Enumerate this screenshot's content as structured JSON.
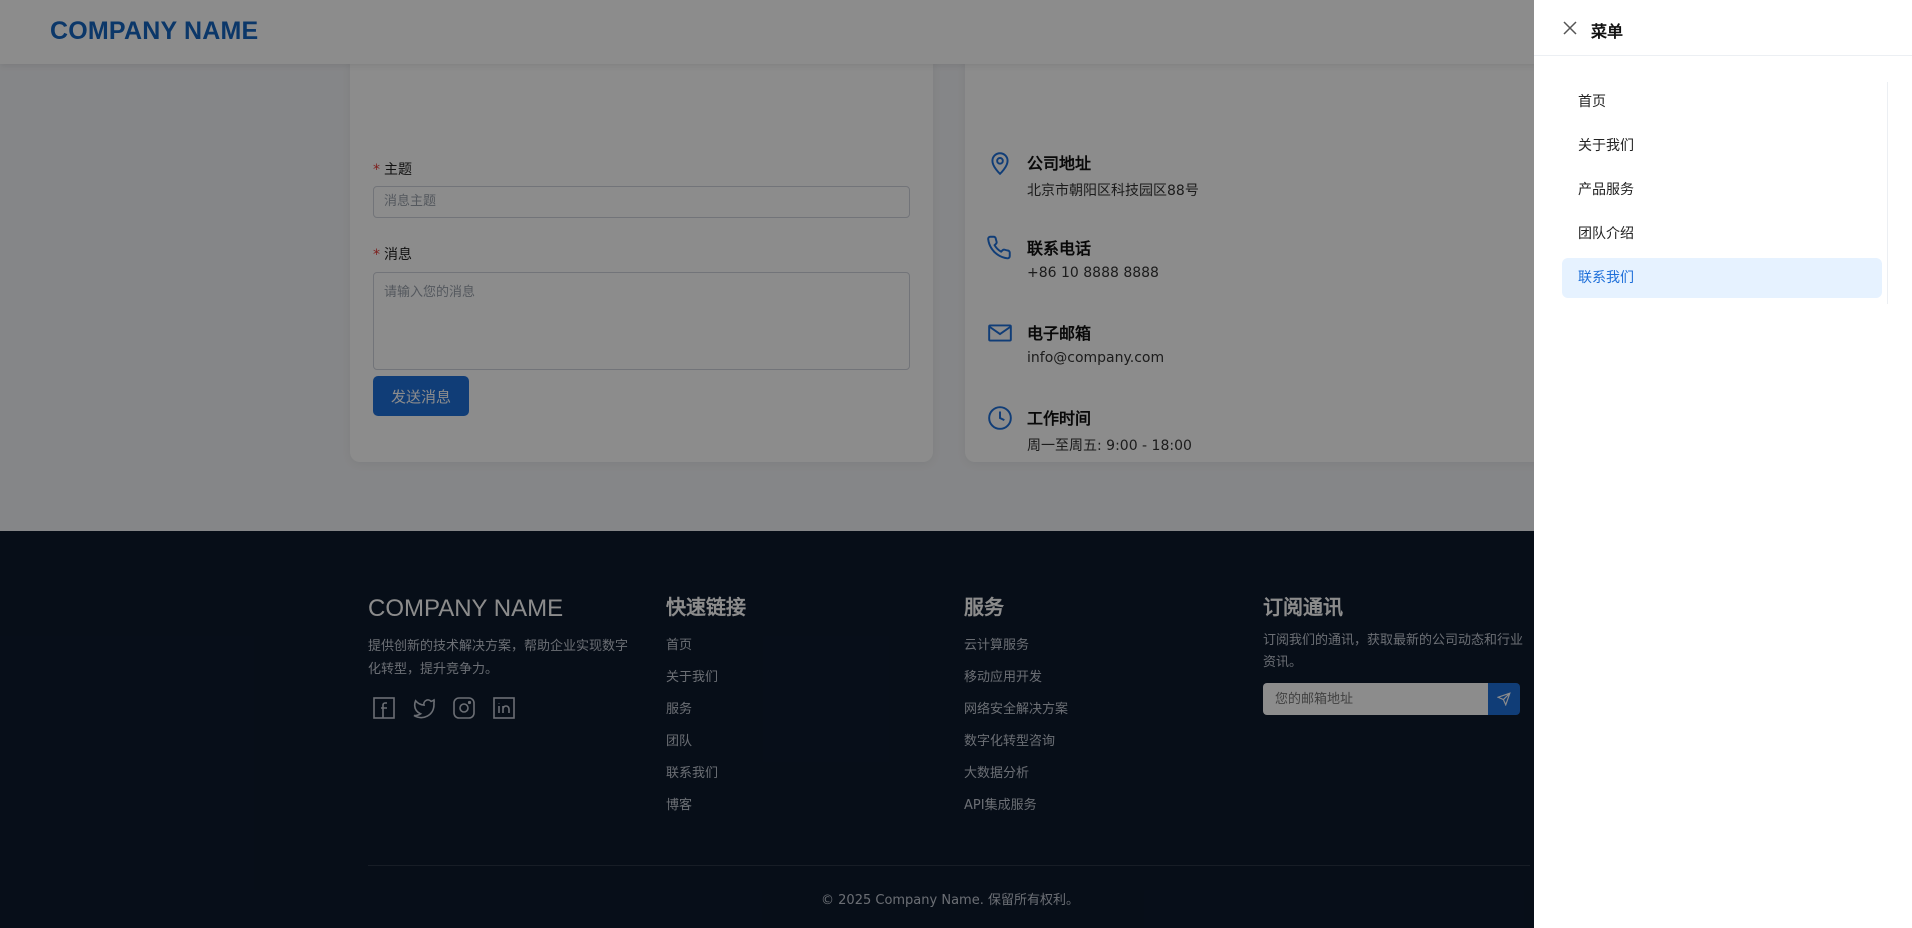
{
  "header": {
    "logo": "COMPANY NAME"
  },
  "form": {
    "subject_label": "主题",
    "subject_placeholder": "消息主题",
    "message_label": "消息",
    "message_placeholder": "请输入您的消息",
    "required_mark": "*",
    "send_label": "发送消息"
  },
  "contact_info": [
    {
      "icon": "location-pin-icon",
      "title": "公司地址",
      "value": "北京市朝阳区科技园区88号"
    },
    {
      "icon": "phone-icon",
      "title": "联系电话",
      "value": "+86 10 8888 8888"
    },
    {
      "icon": "mail-icon",
      "title": "电子邮箱",
      "value": "info@company.com"
    },
    {
      "icon": "clock-icon",
      "title": "工作时间",
      "value": "周一至周五: 9:00 - 18:00"
    }
  ],
  "footer": {
    "brand": "COMPANY NAME",
    "description": "提供创新的技术解决方案，帮助企业实现数字化转型，提升竞争力。",
    "socials": [
      "facebook-icon",
      "twitter-icon",
      "instagram-icon",
      "linkedin-icon"
    ],
    "quick_links": {
      "title": "快速链接",
      "items": [
        "首页",
        "关于我们",
        "服务",
        "团队",
        "联系我们",
        "博客"
      ]
    },
    "services": {
      "title": "服务",
      "items": [
        "云计算服务",
        "移动应用开发",
        "网络安全解决方案",
        "数字化转型咨询",
        "大数据分析",
        "API集成服务"
      ]
    },
    "newsletter": {
      "title": "订阅通讯",
      "description": "订阅我们的通讯，获取最新的公司动态和行业资讯。",
      "placeholder": "您的邮箱地址"
    },
    "copyright": "© 2025 Company Name. 保留所有权利。"
  },
  "drawer": {
    "title": "菜单",
    "items": [
      {
        "label": "首页",
        "active": false
      },
      {
        "label": "关于我们",
        "active": false
      },
      {
        "label": "产品服务",
        "active": false
      },
      {
        "label": "团队介绍",
        "active": false
      },
      {
        "label": "联系我们",
        "active": true
      }
    ]
  },
  "colors": {
    "accent": "#1e6fd9",
    "brand": "#1565c0",
    "footer_bg": "#0d1a2d",
    "active_bg": "#e6f2ff"
  }
}
